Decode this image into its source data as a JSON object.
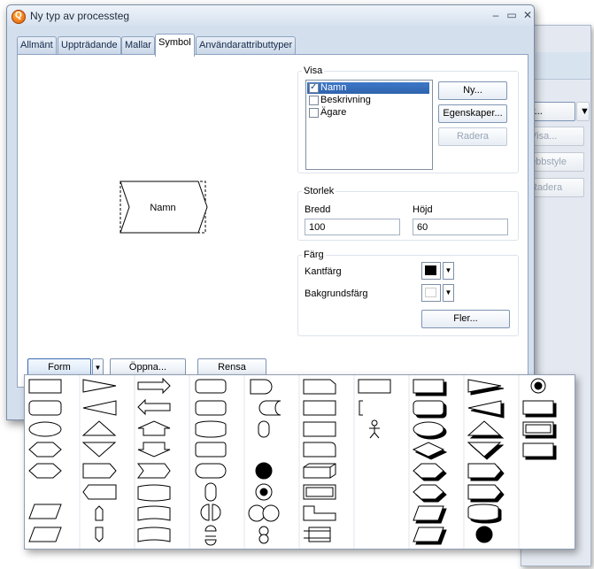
{
  "window": {
    "title": "Ny typ av processteg",
    "minimize": "–",
    "maximize": "▭",
    "close": "✕"
  },
  "tabs": [
    {
      "label": "Allmänt"
    },
    {
      "label": "Uppträdande"
    },
    {
      "label": "Mallar"
    },
    {
      "label": "Symbol",
      "active": true
    },
    {
      "label": "Användarattributtyper"
    }
  ],
  "preview": {
    "shape_label": "Namn"
  },
  "visa": {
    "legend": "Visa",
    "items": [
      {
        "label": "Namn",
        "checked": true,
        "selected": true
      },
      {
        "label": "Beskrivning",
        "checked": false
      },
      {
        "label": "Ägare",
        "checked": false
      }
    ],
    "new_button": "Ny...",
    "properties_button": "Egenskaper...",
    "remove_button": "Radera"
  },
  "storlek": {
    "legend": "Storlek",
    "width_label": "Bredd",
    "width_value": "100",
    "height_label": "Höjd",
    "height_value": "60"
  },
  "farg": {
    "legend": "Färg",
    "border_label": "Kantfärg",
    "border_color": "#000000",
    "bg_label": "Bakgrundsfärg",
    "bg_color": "#ffffff",
    "more_button": "Fler..."
  },
  "bottom": {
    "form_button": "Form",
    "dropdown_arrow": "▼",
    "open_button": "Öppna...",
    "clear_button": "Rensa"
  },
  "background_window": {
    "button_1": "y...",
    "button_2": "Visa...",
    "button_3": "ebbstyle",
    "button_4": "Radera",
    "arrow": "▼"
  },
  "palette": {
    "icons": [
      "rectangle",
      "arrow",
      "block-arrow",
      "cylinder",
      "delay",
      "document",
      "annotation",
      "shadow-shape",
      "shadow-arrow",
      "misc"
    ]
  },
  "colors": {
    "accent": "#2f63ad",
    "window_bg": "#d4dfee"
  }
}
